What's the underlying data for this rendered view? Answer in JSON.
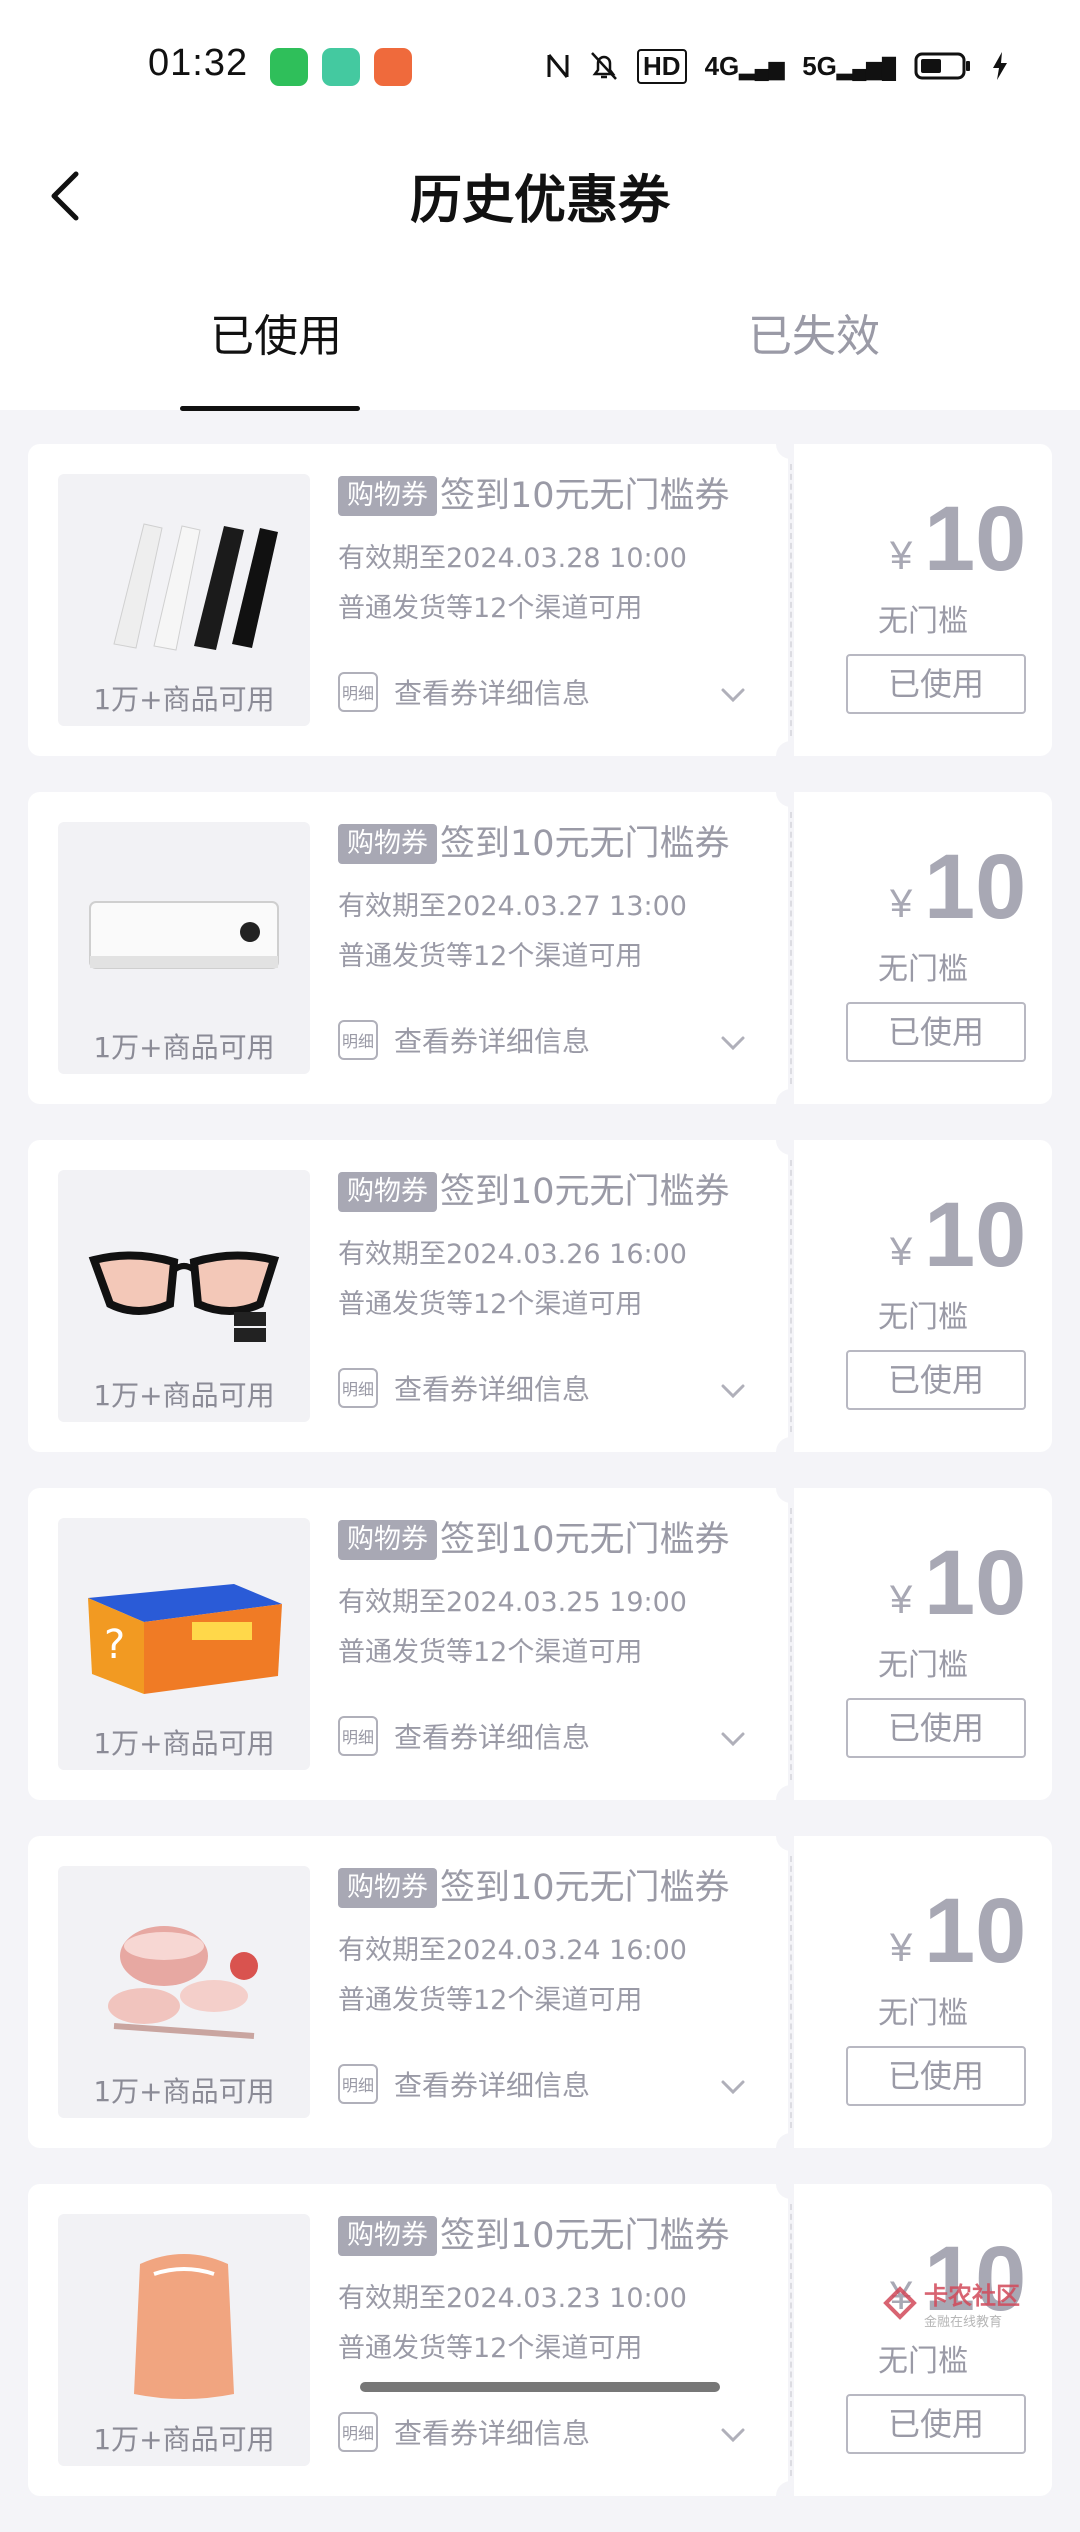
{
  "status_bar": {
    "time": "01:32",
    "network_labels": [
      "HD",
      "4G",
      "5G"
    ],
    "icons": [
      "nfc-icon",
      "mute-icon",
      "hd-icon",
      "signal-4g-icon",
      "signal-5g-icon",
      "battery-icon",
      "charging-icon"
    ]
  },
  "header": {
    "title": "历史优惠券",
    "back_icon": "chevron-left-icon"
  },
  "tabs": [
    {
      "label": "已使用",
      "active": true
    },
    {
      "label": "已失效",
      "active": false
    }
  ],
  "coupons": [
    {
      "badge": "购物券",
      "title": "签到10元无门槛券",
      "valid_until": "有效期至2024.03.28 10:00",
      "channels": "普通发货等12个渠道可用",
      "detail_icon_label": "明细",
      "detail_label": "查看券详细信息",
      "thumb_caption": "1万+商品可用",
      "product": "arm-sleeves",
      "currency": "¥",
      "amount": "10",
      "threshold": "无门槛",
      "status": "已使用"
    },
    {
      "badge": "购物券",
      "title": "签到10元无门槛券",
      "valid_until": "有效期至2024.03.27 13:00",
      "channels": "普通发货等12个渠道可用",
      "detail_icon_label": "明细",
      "detail_label": "查看券详细信息",
      "thumb_caption": "1万+商品可用",
      "product": "air-conditioner",
      "currency": "¥",
      "amount": "10",
      "threshold": "无门槛",
      "status": "已使用"
    },
    {
      "badge": "购物券",
      "title": "签到10元无门槛券",
      "valid_until": "有效期至2024.03.26 16:00",
      "channels": "普通发货等12个渠道可用",
      "detail_icon_label": "明细",
      "detail_label": "查看券详细信息",
      "thumb_caption": "1万+商品可用",
      "product": "sunglasses",
      "currency": "¥",
      "amount": "10",
      "threshold": "无门槛",
      "status": "已使用"
    },
    {
      "badge": "购物券",
      "title": "签到10元无门槛券",
      "valid_until": "有效期至2024.03.25 19:00",
      "channels": "普通发货等12个渠道可用",
      "detail_icon_label": "明细",
      "detail_label": "查看券详细信息",
      "thumb_caption": "1万+商品可用",
      "product": "tshirt-box",
      "currency": "¥",
      "amount": "10",
      "threshold": "无门槛",
      "status": "已使用"
    },
    {
      "badge": "购物券",
      "title": "签到10元无门槛券",
      "valid_until": "有效期至2024.03.24 16:00",
      "channels": "普通发货等12个渠道可用",
      "detail_icon_label": "明细",
      "detail_label": "查看券详细信息",
      "thumb_caption": "1万+商品可用",
      "product": "tableware",
      "currency": "¥",
      "amount": "10",
      "threshold": "无门槛",
      "status": "已使用"
    },
    {
      "badge": "购物券",
      "title": "签到10元无门槛券",
      "valid_until": "有效期至2024.03.23 10:00",
      "channels": "普通发货等12个渠道可用",
      "detail_icon_label": "明细",
      "detail_label": "查看券详细信息",
      "thumb_caption": "1万+商品可用",
      "product": "orange-device",
      "currency": "¥",
      "amount": "10",
      "threshold": "无门槛",
      "status": "已使用"
    }
  ],
  "watermark": {
    "title": "卡农社区",
    "subtitle": "金融在线教育"
  }
}
